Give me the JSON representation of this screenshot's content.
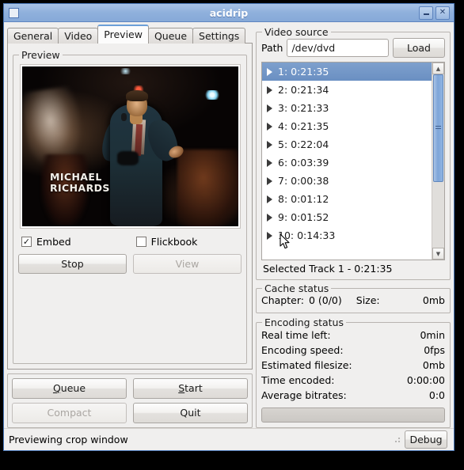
{
  "window": {
    "title": "acidrip",
    "icon": "window-icon",
    "minimize_label": "minimize-icon",
    "close_label": "✕"
  },
  "tabs": [
    {
      "label": "General",
      "active": false
    },
    {
      "label": "Video",
      "active": false
    },
    {
      "label": "Preview",
      "active": true
    },
    {
      "label": "Queue",
      "active": false
    },
    {
      "label": "Settings",
      "active": false
    }
  ],
  "preview": {
    "frame_title": "Preview",
    "video_credits_line1": "MICHAEL",
    "video_credits_line2": "RICHARDS",
    "checkboxes": [
      {
        "label": "Embed",
        "checked": true,
        "mark": "✓"
      },
      {
        "label": "Flickbook",
        "checked": false,
        "mark": ""
      }
    ],
    "stop_button": "Stop",
    "view_button": "View",
    "view_disabled": true
  },
  "bottom_buttons": {
    "queue": "Queue",
    "queue_mnemonic": "Q",
    "start": "Start",
    "start_mnemonic": "S",
    "compact": "Compact",
    "compact_disabled": true,
    "quit": "Quit"
  },
  "video_source": {
    "frame_title": "Video source",
    "path_label": "Path",
    "path_value": "/dev/dvd",
    "path_placeholder": "/dev/dvd",
    "load_button": "Load",
    "tracks": [
      {
        "label": "1: 0:21:35",
        "selected": true
      },
      {
        "label": "2: 0:21:34",
        "selected": false
      },
      {
        "label": "3: 0:21:33",
        "selected": false
      },
      {
        "label": "4: 0:21:35",
        "selected": false
      },
      {
        "label": "5: 0:22:04",
        "selected": false
      },
      {
        "label": "6: 0:03:39",
        "selected": false
      },
      {
        "label": "7: 0:00:38",
        "selected": false
      },
      {
        "label": "8: 0:01:12",
        "selected": false
      },
      {
        "label": "9: 0:01:52",
        "selected": false
      },
      {
        "label": "10: 0:14:33",
        "selected": false
      }
    ],
    "selected_track_text": "Selected Track 1 - 0:21:35",
    "scroll_up_icon": "▲",
    "scroll_down_icon": "▼"
  },
  "cache_status": {
    "frame_title": "Cache status",
    "chapter_label": "Chapter:",
    "chapter_value": "0 (0/0)",
    "size_label": "Size:",
    "size_value": "0mb"
  },
  "encoding_status": {
    "frame_title": "Encoding status",
    "rows": [
      {
        "label": "Real time left:",
        "value": "0min"
      },
      {
        "label": "Encoding speed:",
        "value": "0fps"
      },
      {
        "label": "Estimated filesize:",
        "value": "0mb"
      },
      {
        "label": "Time encoded:",
        "value": "0:00:00"
      },
      {
        "label": "Average bitrates:",
        "value": "0:0"
      }
    ],
    "progress_percent": 0
  },
  "statusbar": {
    "message": "Previewing crop window",
    "debug_button": "Debug"
  },
  "colors": {
    "titlebar": "#8fb0dc",
    "window_bg": "#f0efee",
    "selection": "#6f93c4",
    "tab_active_top": "#6c9fd8",
    "entry_bg": "#ffffff"
  }
}
